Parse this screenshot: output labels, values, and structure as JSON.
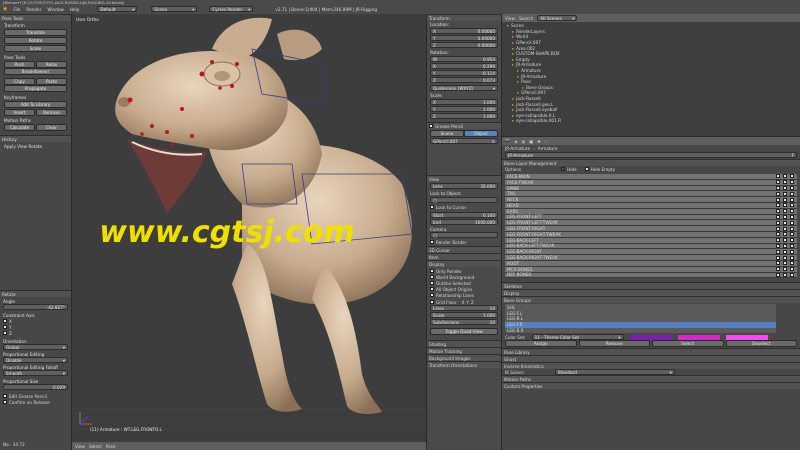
{
  "window": {
    "title": "[Blender* [E:\\TUTOS\\TUTO-JACK RUSSELL\\JR-RIGGING-19.blend]"
  },
  "top_menu": [
    "File",
    "Render",
    "Window",
    "Help"
  ],
  "top_header": {
    "layout": "Default",
    "scene": "Scene",
    "engine": "Cycles Render",
    "stats": "v2.71 | Bones:1/404 | Mem:246.89M | JR-Rigging"
  },
  "tool_shelf": {
    "title": "Pose Tools",
    "sections": [
      {
        "name": "Transform",
        "buttons": [
          "Translate",
          "Rotate",
          "Scale"
        ]
      },
      {
        "name": "Pose Tools",
        "buttons": [
          "Push",
          "Relax",
          "Breakdowner"
        ]
      },
      {
        "name": "",
        "buttons": [
          "Copy",
          "Paste",
          "Propagate"
        ]
      },
      {
        "name": "Keyframes",
        "buttons": [
          "Add To Library",
          "Insert",
          "Remove"
        ]
      },
      {
        "name": "Motion Paths",
        "buttons": [
          "Calculate",
          "Clear"
        ]
      }
    ],
    "history": "History",
    "repeat": "Apply View Rotate"
  },
  "operator_panel": {
    "title": "Rotate",
    "angle_label": "Angle",
    "angle_value": "-42.827°",
    "constraint_label": "Constraint Axis",
    "axes": [
      "X",
      "Y",
      "Z"
    ],
    "orientation_label": "Orientation",
    "orientation_value": "Global",
    "proportional_label": "Proportional Editing",
    "proportional_value": "Disable",
    "falloff_label": "Proportional Editing Falloff",
    "falloff_value": "Smooth",
    "prop_size_label": "Proportional Size",
    "prop_size_value": "0.029",
    "edit_grease": "Edit Grease Pencil",
    "confirm": "Confirm on Release",
    "status": "No : 34.72"
  },
  "viewport": {
    "title": "User Ortho",
    "watermark": "www.cgtsj.com",
    "footer_label": "(11) Armature : WT.LEG.FRONTO.L",
    "footer_menus": [
      "View",
      "Select",
      "Pose"
    ]
  },
  "properties_n": {
    "transform_title": "Transform",
    "location_label": "Location:",
    "location": [
      {
        "axis": "X",
        "value": "0.00000"
      },
      {
        "axis": "Y",
        "value": "0.00000"
      },
      {
        "axis": "Z",
        "value": "0.00000"
      }
    ],
    "rotation_label": "Rotation:",
    "rotation": [
      {
        "axis": "W",
        "value": "0.954"
      },
      {
        "axis": "X",
        "value": "0.296"
      },
      {
        "axis": "Y",
        "value": "-0.114"
      },
      {
        "axis": "Z",
        "value": "0.073"
      }
    ],
    "mode": "Quaternion (WXYZ)",
    "scale_label": "Scale:",
    "scale": [
      {
        "axis": "X",
        "value": "1.000"
      },
      {
        "axis": "Y",
        "value": "1.000"
      },
      {
        "axis": "Z",
        "value": "1.000"
      }
    ],
    "grease_title": "Grease Pencil",
    "scene_tab": "Scene",
    "object_tab": "Object",
    "gp_layer": "GPencil.007",
    "view_title": "View",
    "lens_label": "Lens",
    "lens_value": "35.000",
    "lock_label": "Lock to Object:",
    "lock_cursor": "Lock to Cursor",
    "clip_start_label": "Start",
    "clip_start_value": "0.100",
    "clip_end_label": "End",
    "clip_end_value": "1000.000",
    "camera_label": "Camera",
    "render_border": "Render Border",
    "cursor_3d": "3D Cursor",
    "item_label": "Item",
    "display_title": "Display",
    "display_opts": [
      "Only Render",
      "World Background",
      "Outline Selected",
      "All Object Origins",
      "Relationship Lines"
    ],
    "grid_floor": "Grid Floor",
    "grid_axes": [
      "X",
      "Y",
      "Z"
    ],
    "lines_label": "Lines",
    "lines_value": "16",
    "scale_grid_label": "Scale",
    "scale_grid_value": "1.000",
    "subdiv_label": "Subdivisions",
    "subdiv_value": "10",
    "toggle_quad": "Toggle Quad View",
    "shading_title": "Shading",
    "motion_title": "Motion Tracking",
    "bg_title": "Background Images",
    "orient_title": "Transform Orientations"
  },
  "outliner": {
    "view_menus": [
      "View",
      "Search",
      "All Scenes"
    ],
    "items": [
      "Scene",
      "RenderLayers",
      "World",
      "GPencil.007",
      "Area.002",
      "CUSTOM-SHAPE.BOX",
      "Empty",
      "JR-Armature",
      "Armature",
      "JR-Armature",
      "Pose",
      "Bone Groups",
      "GPencil.007",
      "jack-Russell",
      "jack-Russell.geo.L",
      "jack-Russell.eyeball",
      "eye-collapsible.0.L",
      "eye-collapsible.001.R"
    ]
  },
  "bone_props": {
    "context_tabs": [
      "JR-Armature",
      "Armature"
    ],
    "armature_name": "JR-Armature",
    "blm_title": "Bone Layer Management",
    "options_label": "Options",
    "hide_label": "Hide",
    "hide_empty": "Hide Empty",
    "layers": [
      "FACE-MAIN",
      "FACE-TWEAK",
      "SPINE",
      "TAIL",
      "NECK",
      "HEAD",
      "EARS",
      "LEG-FRONT-LEFT",
      "LEG-FRONT-LEFT-TWEAK",
      "LEG-FRONT-RIGHT",
      "LEG-FRONT-RIGHT-TWEAK",
      "LEG-BACK-LEFT",
      "LEG-BACK-LEFT-TWEAK",
      "LEG-BACK-RIGHT",
      "LEG-BACK-RIGHT-TWEAK",
      "ROOT",
      "MCH BONES",
      "DEF BONES"
    ],
    "skeleton_title": "Skeleton",
    "display_title": "Display",
    "groups_title": "Bone Groups",
    "groups": [
      "SHL",
      "LEG-F.L",
      "LEG-B.L",
      "LEG-F.R",
      "LEG-B.R"
    ],
    "selected_group_index": 3,
    "color_set_label": "Color Set:",
    "color_set_value": "11 - Theme Color Set",
    "group_buttons": [
      "Assign",
      "Remove",
      "Select",
      "Deselect"
    ],
    "pose_library": "Pose Library",
    "ghost": "Ghost",
    "ik_title": "Inverse Kinematics",
    "ik_solver_label": "IK Solver:",
    "ik_solver_value": "Standard",
    "motion_paths": "Motion Paths",
    "custom_props": "Custom Properties",
    "colors": {
      "accent": "#5680c2",
      "colorset_a": "#7a1fa8",
      "colorset_b": "#d02ac8",
      "colorset_c": "#f14cf2"
    }
  }
}
